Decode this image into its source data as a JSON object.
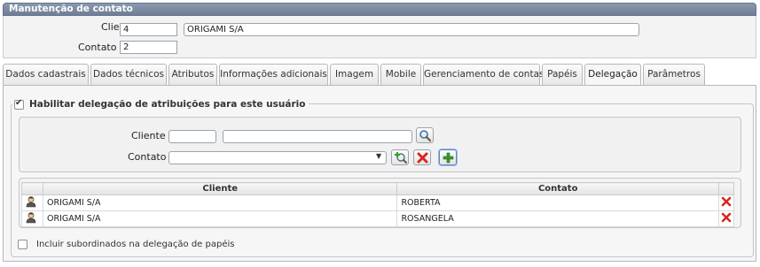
{
  "header": {
    "title": "Manutenção de contato"
  },
  "form": {
    "cliente_label": "Cliente",
    "required_mark": "*",
    "label_sep": ":",
    "cliente_code": "4",
    "cliente_name": "ORIGAMI S/A",
    "contato_label": "Contato :",
    "contato_value": "2"
  },
  "tabs": [
    {
      "label": "Dados cadastrais"
    },
    {
      "label": "Dados técnicos"
    },
    {
      "label": "Atributos"
    },
    {
      "label": "Informações adicionais"
    },
    {
      "label": "Imagem"
    },
    {
      "label": "Mobile"
    },
    {
      "label": "Gerenciamento de contas"
    },
    {
      "label": "Papéis"
    },
    {
      "label": "Delegação",
      "active": true
    },
    {
      "label": "Parâmetros"
    }
  ],
  "delegation": {
    "enable_label": "Habilitar delegação de atribuições para este usuário",
    "enable_checked": true,
    "filter": {
      "cliente_label": "Cliente :",
      "cliente_code": "",
      "cliente_name": "",
      "contato_label": "Contato :",
      "contato_value": ""
    },
    "grid": {
      "columns": [
        "Cliente",
        "Contato"
      ],
      "rows": [
        {
          "cliente": "ORIGAMI S/A",
          "contato": "ROBERTA"
        },
        {
          "cliente": "ORIGAMI S/A",
          "contato": "ROSANGELA"
        }
      ]
    },
    "include_label": "Incluir subordinados na delegação de papéis",
    "include_checked": false
  },
  "icons": {
    "search": "search-icon",
    "add_search": "add-search-icon",
    "remove": "remove-icon",
    "add": "add-icon",
    "user": "user-icon",
    "delete": "delete-icon"
  },
  "colors": {
    "header_bg": "#7a889f",
    "delete_red": "#d8281e",
    "add_green": "#3a9a2c"
  }
}
